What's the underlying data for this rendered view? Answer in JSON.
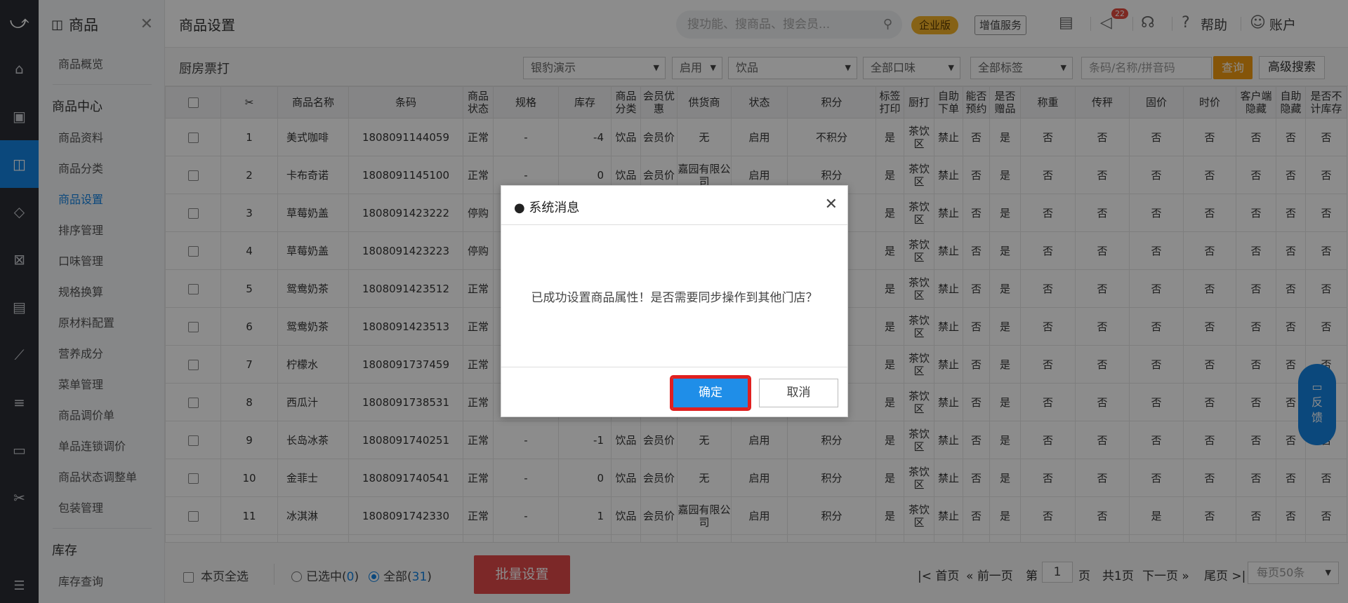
{
  "rail": {
    "icons": [
      "logo-icon",
      "home-icon",
      "cashier-icon",
      "goods-icon",
      "member-icon",
      "marketing-icon",
      "staff-icon",
      "report-icon",
      "settings-icon",
      "device-icon",
      "tools-icon",
      "more-icon"
    ]
  },
  "sidebar": {
    "title": "商品",
    "items_top": [
      "商品概览"
    ],
    "group1": "商品中心",
    "items": [
      "商品资料",
      "商品分类",
      "商品设置",
      "排序管理",
      "口味管理",
      "规格换算",
      "原材料配置",
      "营养成分",
      "菜单管理",
      "商品调价单",
      "单品连锁调价",
      "商品状态调整单",
      "包装管理"
    ],
    "active": "商品设置",
    "group2": "库存",
    "items2": [
      "库存查询"
    ]
  },
  "topbar": {
    "title": "商品设置",
    "search_placeholder": "搜功能、搜商品、搜会员...",
    "enterprise": "企业版",
    "value_added": "增值服务",
    "msg_count": "22",
    "help": "帮助",
    "account": "账户"
  },
  "filters": {
    "title": "厨房票打",
    "store": "银豹演示",
    "status": "启用",
    "category": "饮品",
    "flavor": "全部口味",
    "tag": "全部标签",
    "search_placeholder": "条码/名称/拼音码",
    "query": "查询",
    "advanced": "高级搜索"
  },
  "table": {
    "headers": [
      "",
      "",
      "商品名称",
      "条码",
      "商品状态",
      "规格",
      "库存",
      "商品分类",
      "会员优惠",
      "供货商",
      "状态",
      "积分",
      "标签打印",
      "厨打",
      "自助下单",
      "能否预约",
      "是否赠品",
      "称重",
      "传秤",
      "固价",
      "时价",
      "客户端隐藏",
      "自助隐藏",
      "是否不计库存"
    ],
    "rows": [
      [
        "1",
        "美式咖啡",
        "1808091144059",
        "正常",
        "-",
        "-4",
        "饮品",
        "会员价",
        "无",
        "启用",
        "不积分",
        "是",
        "茶饮区",
        "禁止",
        "否",
        "是",
        "否",
        "否",
        "否",
        "否",
        "否",
        "否",
        "否"
      ],
      [
        "2",
        "卡布奇诺",
        "1808091145100",
        "正常",
        "-",
        "0",
        "饮品",
        "会员价",
        "嘉园有限公司",
        "启用",
        "积分",
        "是",
        "茶饮区",
        "禁止",
        "否",
        "是",
        "否",
        "否",
        "否",
        "否",
        "否",
        "否",
        "否"
      ],
      [
        "3",
        "草莓奶盖",
        "1808091423222",
        "停购",
        "",
        "",
        "",
        "",
        "",
        "",
        "",
        "是",
        "茶饮区",
        "禁止",
        "否",
        "是",
        "否",
        "否",
        "否",
        "否",
        "否",
        "否",
        "否"
      ],
      [
        "4",
        "草莓奶盖",
        "1808091423223",
        "停购",
        "",
        "",
        "",
        "",
        "",
        "",
        "",
        "是",
        "茶饮区",
        "禁止",
        "否",
        "是",
        "否",
        "否",
        "否",
        "否",
        "否",
        "否",
        "否"
      ],
      [
        "5",
        "鸳鸯奶茶",
        "1808091423512",
        "正常",
        "",
        "",
        "",
        "",
        "",
        "",
        "",
        "是",
        "茶饮区",
        "禁止",
        "否",
        "是",
        "否",
        "否",
        "否",
        "否",
        "否",
        "否",
        "否"
      ],
      [
        "6",
        "鸳鸯奶茶",
        "1808091423513",
        "正常",
        "",
        "",
        "",
        "",
        "",
        "",
        "",
        "是",
        "茶饮区",
        "禁止",
        "否",
        "是",
        "否",
        "否",
        "否",
        "否",
        "否",
        "否",
        "否"
      ],
      [
        "7",
        "柠檬水",
        "1808091737459",
        "正常",
        "",
        "",
        "",
        "",
        "",
        "",
        "",
        "是",
        "茶饮区",
        "禁止",
        "否",
        "是",
        "否",
        "否",
        "否",
        "否",
        "否",
        "否",
        "否"
      ],
      [
        "8",
        "西瓜汁",
        "1808091738531",
        "正常",
        "",
        "",
        "",
        "",
        "",
        "",
        "",
        "是",
        "茶饮区",
        "禁止",
        "否",
        "是",
        "否",
        "否",
        "否",
        "否",
        "否",
        "否",
        "否"
      ],
      [
        "9",
        "长岛冰茶",
        "1808091740251",
        "正常",
        "-",
        "-1",
        "饮品",
        "会员价",
        "无",
        "启用",
        "积分",
        "是",
        "茶饮区",
        "禁止",
        "否",
        "是",
        "否",
        "否",
        "否",
        "否",
        "否",
        "否",
        "否"
      ],
      [
        "10",
        "金菲士",
        "1808091740541",
        "正常",
        "-",
        "0",
        "饮品",
        "会员价",
        "无",
        "启用",
        "积分",
        "是",
        "茶饮区",
        "禁止",
        "否",
        "是",
        "否",
        "否",
        "否",
        "否",
        "否",
        "否",
        "否"
      ],
      [
        "11",
        "冰淇淋",
        "1808091742330",
        "正常",
        "-",
        "1",
        "饮品",
        "会员价",
        "嘉园有限公司",
        "启用",
        "积分",
        "是",
        "茶饮区",
        "禁止",
        "否",
        "是",
        "否",
        "否",
        "是",
        "否",
        "否",
        "否",
        "否"
      ],
      [
        "",
        "",
        "",
        "",
        "",
        "",
        "饮",
        "会员",
        "嘉园有",
        "",
        "",
        "",
        "茶",
        "",
        "",
        "",
        "",
        "",
        "",
        "",
        "",
        "",
        ""
      ]
    ]
  },
  "footer": {
    "select_page": "本页全选",
    "selected": "已选中(",
    "selected_count": "0",
    "selected_close": ")",
    "all": "全部(",
    "all_count": "31",
    "all_close": ")",
    "batch": "批量设置",
    "first": "首页",
    "prev": "前一页",
    "page_prefix": "第",
    "page_num": "1",
    "page_suffix": "页",
    "total_pages": "共1页",
    "next": "下一页",
    "last": "尾页",
    "page_size": "每页50条"
  },
  "feedback": {
    "label1": "反",
    "label2": "馈"
  },
  "modal": {
    "title": "● 系统消息",
    "message": "已成功设置商品属性！是否需要同步操作到其他门店？",
    "ok": "确定",
    "cancel": "取消"
  }
}
